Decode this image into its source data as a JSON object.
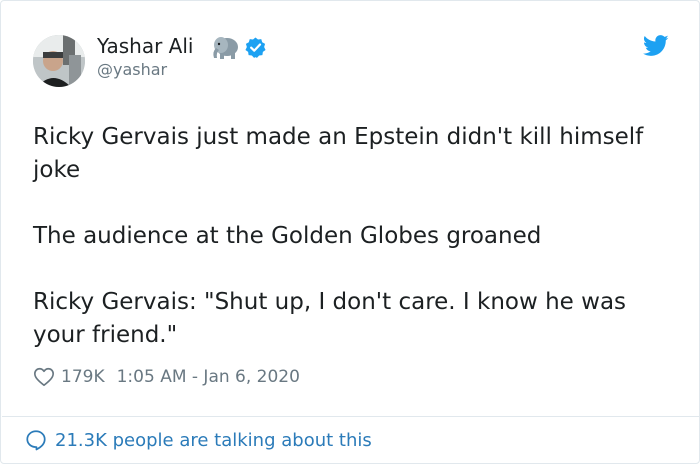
{
  "author": {
    "name": "Yashar Ali",
    "handle": "@yashar",
    "emoji_icon": "elephant-emoji-icon",
    "verified_icon": "verified-badge-icon",
    "avatar_icon": "profile-photo"
  },
  "platform_icon": "twitter-bird-icon",
  "tweet": {
    "paragraphs": [
      "Ricky Gervais just made an Epstein didn't kill himself joke",
      "The audience at the Golden Globes groaned",
      "Ricky Gervais: \"Shut up, I don't care. I know he was your friend.\""
    ]
  },
  "meta": {
    "like_icon": "heart-icon",
    "likes": "179K",
    "timestamp": "1:05 AM - Jan 6, 2020"
  },
  "footer": {
    "icon": "speech-bubble-icon",
    "text": "21.3K people are talking about this"
  },
  "colors": {
    "text": "#1c2022",
    "muted": "#697882",
    "link": "#2b7bb9",
    "verified": "#1da1f2",
    "border": "#e1e8ed"
  }
}
